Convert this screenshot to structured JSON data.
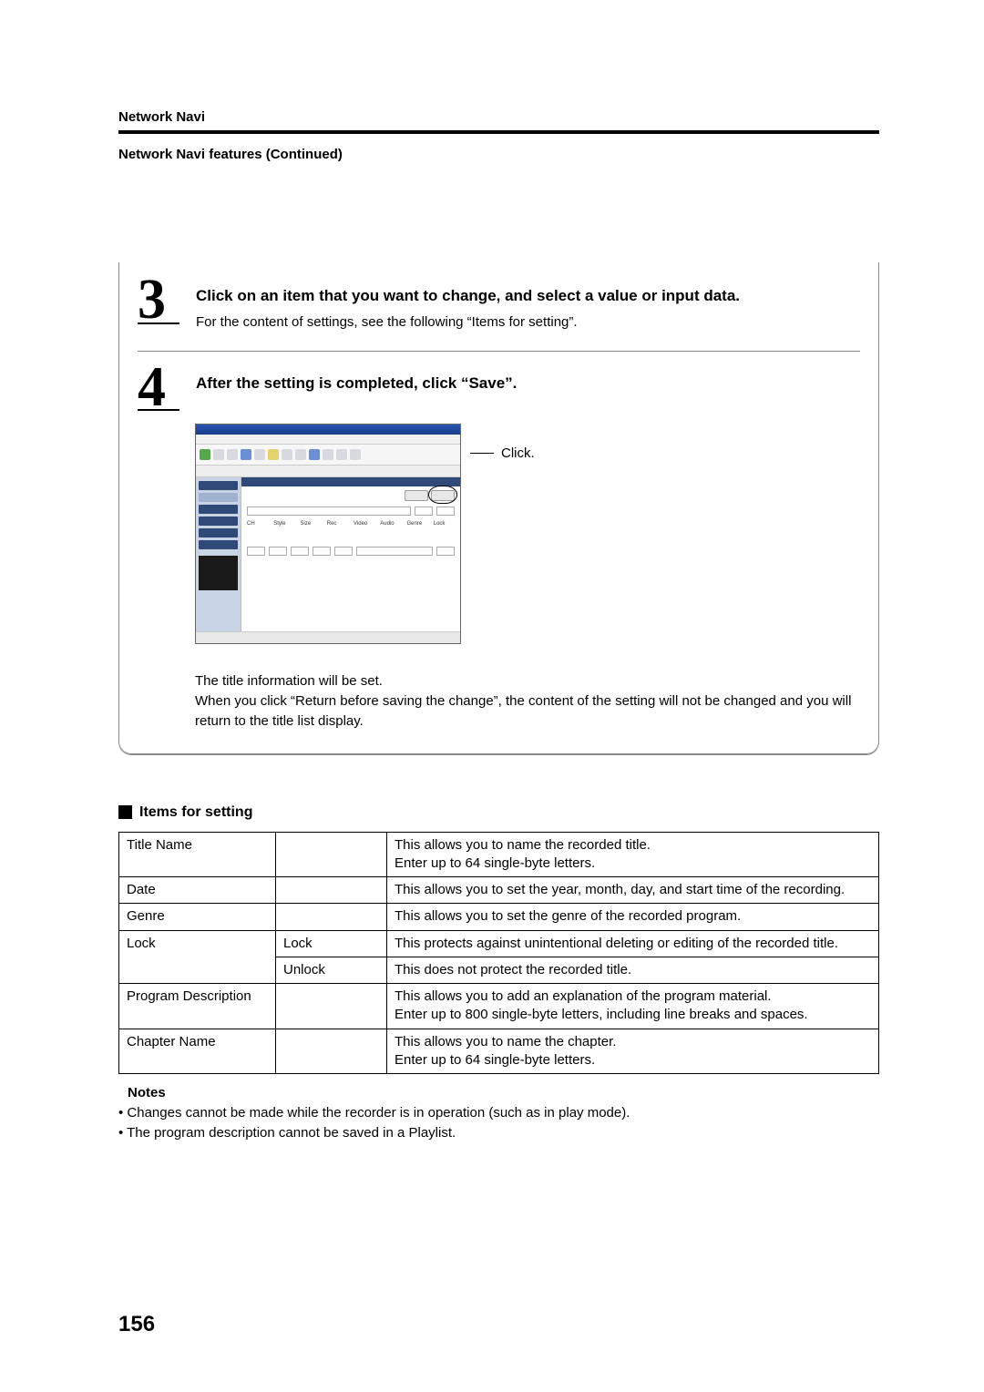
{
  "header": {
    "running": "Network Navi",
    "sub": "Network Navi features (Continued)"
  },
  "steps": {
    "s3": {
      "num": "3",
      "title": "Click on an item that you want to change, and select a value or input data.",
      "desc": "For the content of settings, see the following “Items for setting”."
    },
    "s4": {
      "num": "4",
      "title": "After the setting is completed, click “Save”.",
      "callout": "Click.",
      "after1": "The title information will be set.",
      "after2": "When you click “Return before saving the change”, the content of the setting will not be changed and you will return to the title list display."
    }
  },
  "items": {
    "heading": "Items for setting",
    "rows": {
      "title_name": {
        "c1": "Title Name",
        "c2": "",
        "c3": "This allows you to name the recorded title.\nEnter up to 64 single-byte letters."
      },
      "date": {
        "c1": "Date",
        "c2": "",
        "c3": "This allows you to set the year, month, day, and start time of the recording."
      },
      "genre": {
        "c1": "Genre",
        "c2": "",
        "c3": "This allows you to set the genre of the recorded program."
      },
      "lock_lock": {
        "c1": "Lock",
        "c2": "Lock",
        "c3": "This protects against unintentional deleting or editing of the recorded title."
      },
      "lock_unlock": {
        "c1": "",
        "c2": "Unlock",
        "c3": "This does not protect the recorded title."
      },
      "program_desc": {
        "c1": "Program Description",
        "c2": "",
        "c3": "This allows you to add an explanation of the program material.\nEnter up to 800 single-byte letters, including line breaks and spaces."
      },
      "chapter_name": {
        "c1": "Chapter Name",
        "c2": "",
        "c3": "This allows you to name the chapter.\nEnter up to 64 single-byte letters."
      }
    }
  },
  "notes": {
    "title": "Notes",
    "n1": "• Changes cannot be made while the recorder is in operation (such as in play mode).",
    "n2": "• The program description cannot be saved in a Playlist."
  },
  "page_number": "156"
}
